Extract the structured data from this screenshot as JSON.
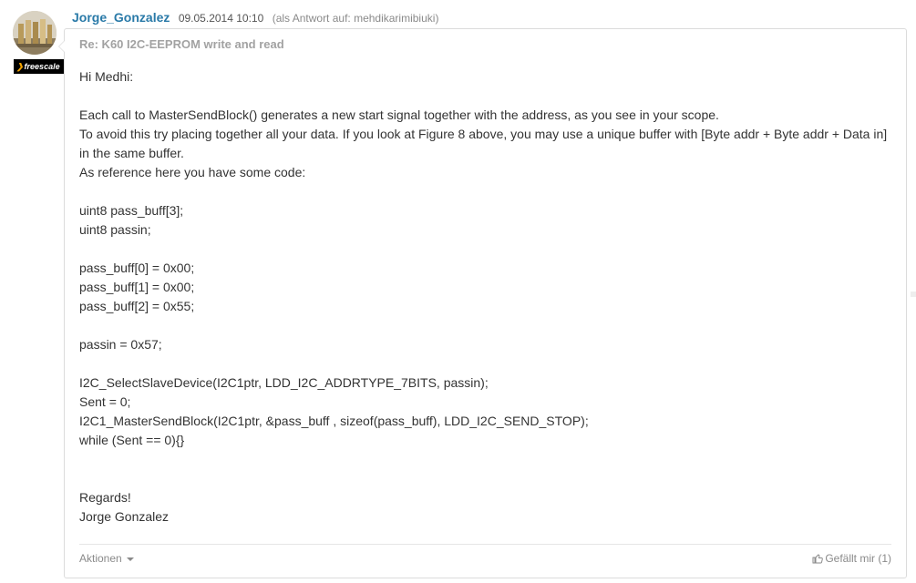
{
  "post": {
    "author": "Jorge_Gonzalez",
    "date": "09.05.2014 10:10",
    "reply_to": "(als Antwort auf: mehdikarimibiuki)",
    "badge": "freescale",
    "subject": "Re: K60 I2C-EEPROM write and read",
    "body_lines": [
      "Hi Medhi:",
      "",
      "Each call to MasterSendBlock() generates a new start signal together with the address, as you see in your scope.",
      "To avoid this try placing together all your data. If you look at Figure 8 above, you may use a unique buffer with [Byte addr + Byte addr + Data in] in the same buffer.",
      "As reference here you have some code:",
      "",
      "uint8  pass_buff[3];",
      "uint8  passin;",
      "",
      "pass_buff[0] = 0x00;",
      "pass_buff[1] = 0x00;",
      "pass_buff[2] = 0x55;",
      "",
      "passin = 0x57;",
      "",
      "I2C_SelectSlaveDevice(I2C1ptr, LDD_I2C_ADDRTYPE_7BITS, passin);",
      "Sent = 0;",
      "I2C1_MasterSendBlock(I2C1ptr, &pass_buff , sizeof(pass_buff), LDD_I2C_SEND_STOP);",
      "while (Sent == 0){}",
      "",
      "",
      "Regards!",
      "Jorge Gonzalez"
    ],
    "actions_label": "Aktionen",
    "like_label": "Gefällt mir (1)"
  },
  "colors": {
    "author": "#2a7aa8",
    "muted": "#8a8a8a",
    "border": "#dcdcdc",
    "badge_accent": "#f3a300"
  },
  "icons": {
    "actions": "caret-down-icon",
    "like": "thumbs-up-icon"
  }
}
